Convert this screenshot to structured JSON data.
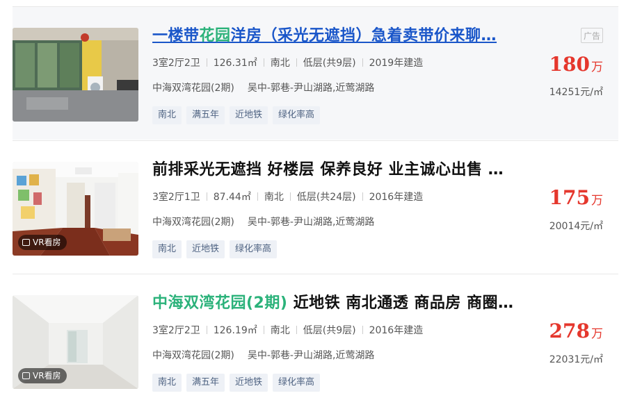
{
  "listings": [
    {
      "title_parts": [
        "一楼带",
        "花园",
        "洋房（采光无遮挡）急着卖带价来聊…"
      ],
      "highlight_index": 1,
      "is_ad": true,
      "ad_label": "广告",
      "vr_label": "",
      "layout": "3室2厅2卫",
      "area": "126.31㎡",
      "orientation": "南北",
      "floor": "低层(共9层)",
      "built": "2019年建造",
      "community": "中海双湾花园(2期)",
      "location": "吴中-郭巷-尹山湖路,近莺湖路",
      "tags": [
        "南北",
        "满五年",
        "近地铁",
        "绿化率高"
      ],
      "price": "180",
      "price_unit": "万",
      "unit_price": "14251元/㎡",
      "accent": "#1a56c9"
    },
    {
      "title_parts": [
        "前排采光无遮挡 好楼层 保养良好 业主诚心出售 …"
      ],
      "highlight_index": -1,
      "is_ad": false,
      "ad_label": "",
      "vr_label": "VR看房",
      "layout": "3室2厅1卫",
      "area": "87.44㎡",
      "orientation": "南北",
      "floor": "低层(共24层)",
      "built": "2016年建造",
      "community": "中海双湾花园(2期)",
      "location": "吴中-郭巷-尹山湖路,近莺湖路",
      "tags": [
        "南北",
        "近地铁",
        "绿化率高"
      ],
      "price": "175",
      "price_unit": "万",
      "unit_price": "20014元/㎡",
      "accent": "#111111"
    },
    {
      "title_parts": [
        "中海双湾花园(2期)",
        " 近地铁 南北通透 商品房 商圈…"
      ],
      "highlight_index": 0,
      "is_ad": false,
      "ad_label": "",
      "vr_label": "VR看房",
      "layout": "3室2厅2卫",
      "area": "126.19㎡",
      "orientation": "南北",
      "floor": "低层(共9层)",
      "built": "2016年建造",
      "community": "中海双湾花园(2期)",
      "location": "吴中-郭巷-尹山湖路,近莺湖路",
      "tags": [
        "南北",
        "满五年",
        "近地铁",
        "绿化率高"
      ],
      "price": "278",
      "price_unit": "万",
      "unit_price": "22031元/㎡",
      "accent": "#111111"
    }
  ],
  "colors": {
    "price": "#e5372d",
    "highlight": "#2bb27a",
    "tag_bg": "#eef1f6",
    "tag_text": "#4f6382",
    "ad_bg": "#f6f7f9"
  }
}
